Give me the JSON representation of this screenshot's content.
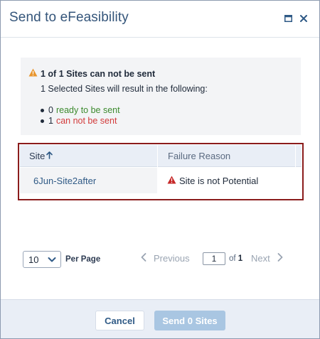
{
  "dialog": {
    "title": "Send to eFeasibility",
    "maximize_icon": "maximize-icon",
    "close_icon": "close-icon"
  },
  "summary": {
    "heading": "1 of 1 Sites can not be sent",
    "subtext": "1 Selected Sites will result in the following:",
    "items": [
      {
        "count": "0",
        "label": "ready to be sent",
        "color": "#3c8a2e"
      },
      {
        "count": "1",
        "label": "can not be sent",
        "color": "#d23b3b"
      }
    ],
    "warning_color": "#e8962f"
  },
  "table": {
    "columns": [
      {
        "label": "Site",
        "sort": "ascending"
      },
      {
        "label": "Failure Reason"
      }
    ],
    "rows": [
      {
        "site": "6Jun-Site2after",
        "reason": "Site is not Potential"
      }
    ],
    "highlight_color": "#8b1c1c",
    "error_icon_color": "#c62828"
  },
  "pagination": {
    "page_size": "10",
    "per_page_label": "Per Page",
    "previous_label": "Previous",
    "current_page": "1",
    "of_label": "of",
    "total_pages": "1",
    "next_label": "Next"
  },
  "footer": {
    "cancel_label": "Cancel",
    "send_label": "Send 0 Sites",
    "send_enabled": false
  }
}
